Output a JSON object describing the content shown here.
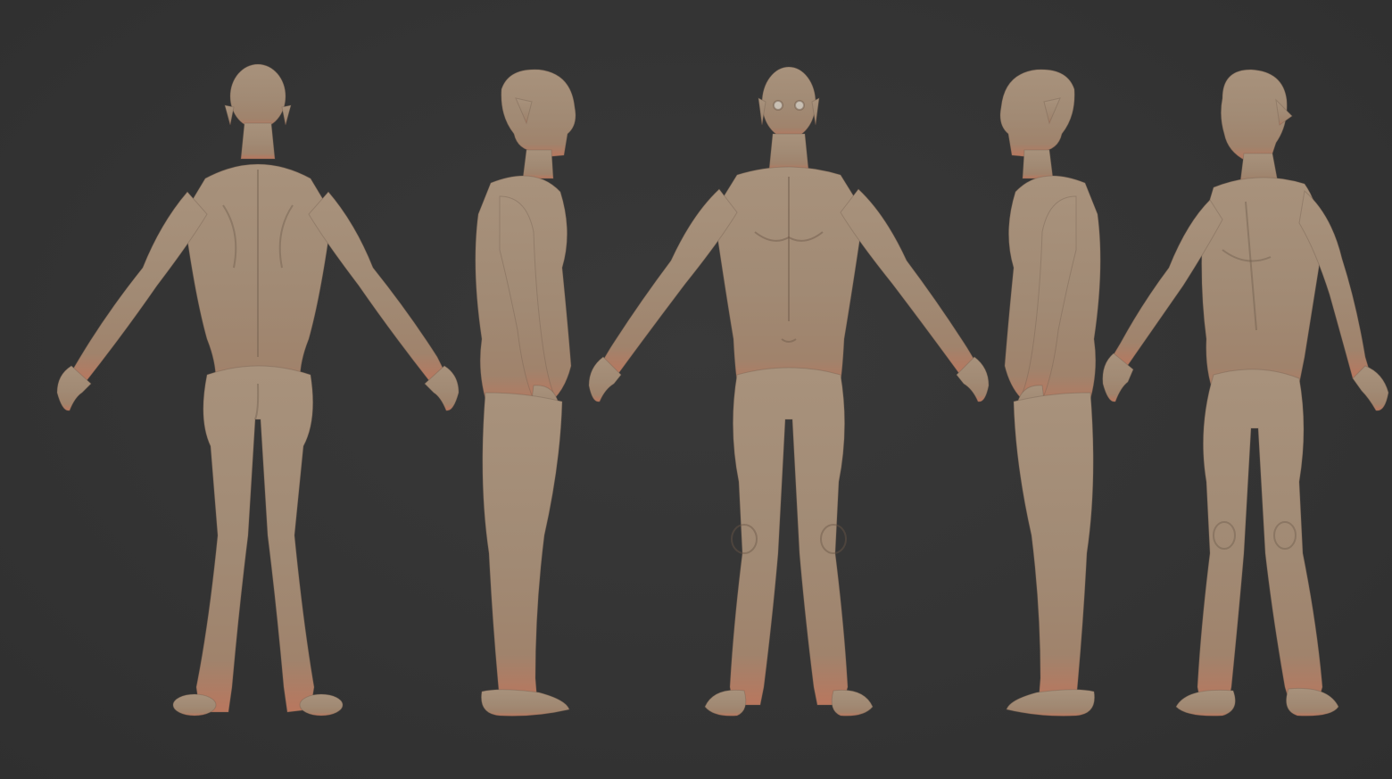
{
  "scene": {
    "background_color": "#333333",
    "skin_base_color": "#a8927c",
    "skin_shadow_color": "#7a6657",
    "skin_warm_color": "#c07a62",
    "views": [
      {
        "view": "back"
      },
      {
        "view": "side-right"
      },
      {
        "view": "front"
      },
      {
        "view": "side-left"
      },
      {
        "view": "three-quarter"
      }
    ]
  }
}
